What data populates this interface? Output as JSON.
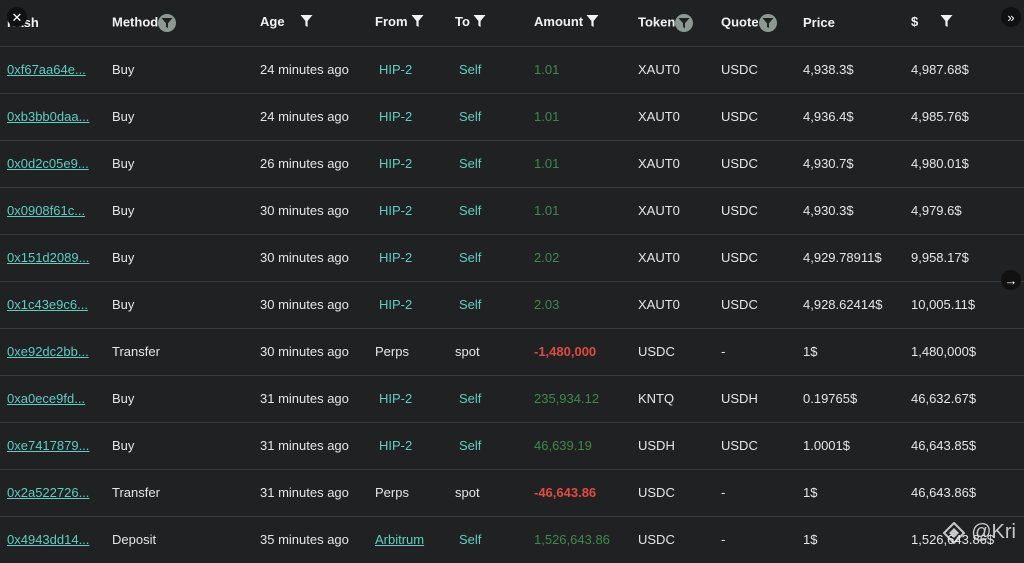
{
  "columns": {
    "hash": "Hash",
    "method": "Method",
    "age": "Age",
    "from": "From",
    "to": "To",
    "amount": "Amount",
    "token": "Token",
    "quote": "Quote",
    "price": "Price",
    "usd": "$"
  },
  "rows": [
    {
      "hash": "0xf67aa64e...",
      "method": "Buy",
      "age": "24 minutes ago",
      "from": "HIP-2",
      "to": "Self",
      "amount": "1.01",
      "token": "XAUT0",
      "quote": "USDC",
      "price": "4,938.3$",
      "usd": "4,987.68$"
    },
    {
      "hash": "0xb3bb0daa...",
      "method": "Buy",
      "age": "24 minutes ago",
      "from": "HIP-2",
      "to": "Self",
      "amount": "1.01",
      "token": "XAUT0",
      "quote": "USDC",
      "price": "4,936.4$",
      "usd": "4,985.76$"
    },
    {
      "hash": "0x0d2c05e9...",
      "method": "Buy",
      "age": "26 minutes ago",
      "from": "HIP-2",
      "to": "Self",
      "amount": "1.01",
      "token": "XAUT0",
      "quote": "USDC",
      "price": "4,930.7$",
      "usd": "4,980.01$"
    },
    {
      "hash": "0x0908f61c...",
      "method": "Buy",
      "age": "30 minutes ago",
      "from": "HIP-2",
      "to": "Self",
      "amount": "1.01",
      "token": "XAUT0",
      "quote": "USDC",
      "price": "4,930.3$",
      "usd": "4,979.6$"
    },
    {
      "hash": "0x151d2089...",
      "method": "Buy",
      "age": "30 minutes ago",
      "from": "HIP-2",
      "to": "Self",
      "amount": "2.02",
      "token": "XAUT0",
      "quote": "USDC",
      "price": "4,929.78911$",
      "usd": "9,958.17$"
    },
    {
      "hash": "0x1c43e9c6...",
      "method": "Buy",
      "age": "30 minutes ago",
      "from": "HIP-2",
      "to": "Self",
      "amount": "2.03",
      "token": "XAUT0",
      "quote": "USDC",
      "price": "4,928.62414$",
      "usd": "10,005.11$"
    },
    {
      "hash": "0xe92dc2bb...",
      "method": "Transfer",
      "age": "30 minutes ago",
      "from": "Perps",
      "to": "spot",
      "amount": "-1,480,000",
      "token": "USDC",
      "quote": "-",
      "price": "1$",
      "usd": "1,480,000$"
    },
    {
      "hash": "0xa0ece9fd...",
      "method": "Buy",
      "age": "31 minutes ago",
      "from": "HIP-2",
      "to": "Self",
      "amount": "235,934.12",
      "token": "KNTQ",
      "quote": "USDH",
      "price": "0.19765$",
      "usd": "46,632.67$"
    },
    {
      "hash": "0xe7417879...",
      "method": "Buy",
      "age": "31 minutes ago",
      "from": "HIP-2",
      "to": "Self",
      "amount": "46,639.19",
      "token": "USDH",
      "quote": "USDC",
      "price": "1.0001$",
      "usd": "46,643.85$"
    },
    {
      "hash": "0x2a522726...",
      "method": "Transfer",
      "age": "31 minutes ago",
      "from": "Perps",
      "to": "spot",
      "amount": "-46,643.86",
      "token": "USDC",
      "quote": "-",
      "price": "1$",
      "usd": "46,643.86$"
    },
    {
      "hash": "0x4943dd14...",
      "method": "Deposit",
      "age": "35 minutes ago",
      "from": "Arbitrum",
      "to": "Self",
      "amount": "1,526,643.86",
      "token": "USDC",
      "quote": "-",
      "price": "1$",
      "usd": "1,526,643.86$"
    }
  ],
  "watermark": "@Kri",
  "colors": {
    "teal": "#5ecfc0",
    "green": "#3f8a4a",
    "red": "#e24b3f",
    "background": "#1f2123"
  }
}
